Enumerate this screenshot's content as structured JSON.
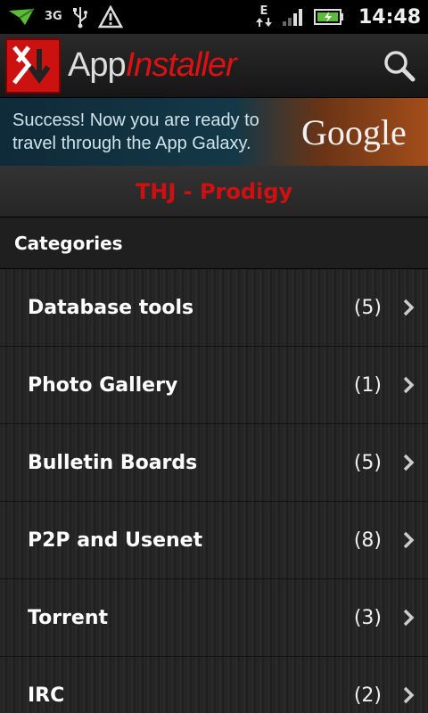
{
  "status_bar": {
    "network_label": "3G",
    "data_label": "E",
    "time": "14:48",
    "icons": [
      "notification-icon",
      "wifi-hotspot-icon",
      "usb-icon",
      "warning-icon",
      "data-transfer-icon",
      "signal-icon",
      "battery-charging-icon"
    ]
  },
  "app_header": {
    "title_part1": "App",
    "title_part2": "Installer",
    "logo_icon": "appinstaller-logo-icon",
    "search_icon": "search-icon"
  },
  "ad_banner": {
    "text": "Success! Now you are ready to travel through the App Galaxy.",
    "brand": "Google"
  },
  "page_title": "THJ - Prodigy",
  "categories_header": "Categories",
  "categories": [
    {
      "label": "Database tools",
      "count": "(5)"
    },
    {
      "label": "Photo Gallery",
      "count": "(1)"
    },
    {
      "label": "Bulletin Boards",
      "count": "(5)"
    },
    {
      "label": "P2P and Usenet",
      "count": "(8)"
    },
    {
      "label": "Torrent",
      "count": "(3)"
    },
    {
      "label": "IRC",
      "count": "(2)"
    }
  ],
  "colors": {
    "accent_red": "#d01010",
    "background": "#1a1a1a"
  }
}
